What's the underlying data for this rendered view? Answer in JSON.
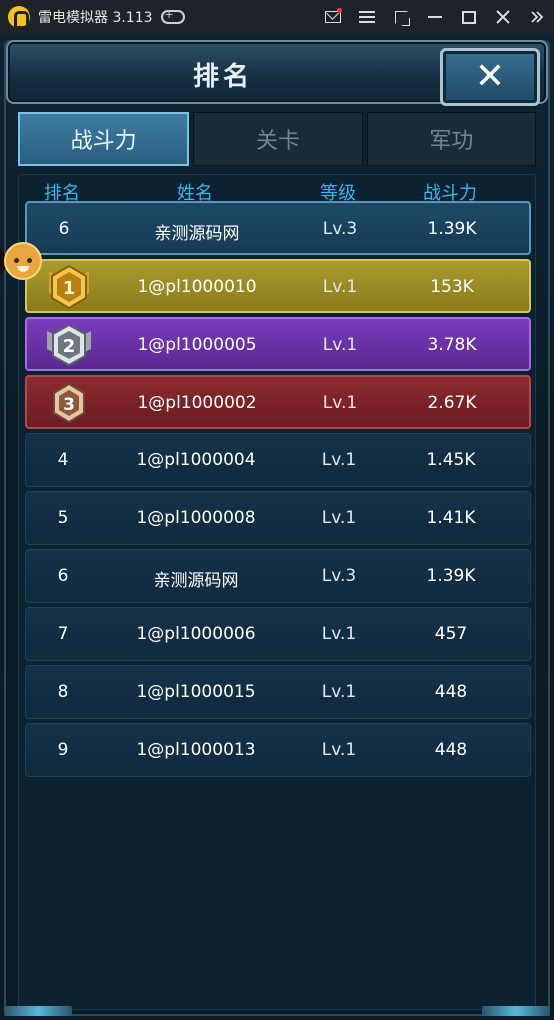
{
  "emulator": {
    "title": "雷电模拟器 3.113",
    "icons": [
      "logo-icon",
      "gamepad-icon",
      "mail-icon",
      "menu-icon",
      "resize-icon",
      "minimize-icon",
      "maximize-icon",
      "close-icon",
      "double-chevron-icon"
    ]
  },
  "header": {
    "title": "排名",
    "close_label": "✕"
  },
  "tabs": [
    {
      "label": "战斗力",
      "active": true
    },
    {
      "label": "关卡",
      "active": false
    },
    {
      "label": "军功",
      "active": false
    }
  ],
  "columns": {
    "rank": "排名",
    "name": "姓名",
    "level": "等级",
    "power": "战斗力"
  },
  "my_rank": {
    "rank": "6",
    "name": "亲测源码网",
    "level": "Lv.3",
    "power": "1.39K"
  },
  "rows": [
    {
      "rank": "1",
      "name": "1@pl1000010",
      "level": "Lv.1",
      "power": "153K",
      "style": "gold"
    },
    {
      "rank": "2",
      "name": "1@pl1000005",
      "level": "Lv.1",
      "power": "3.78K",
      "style": "purple"
    },
    {
      "rank": "3",
      "name": "1@pl1000002",
      "level": "Lv.1",
      "power": "2.67K",
      "style": "red"
    },
    {
      "rank": "4",
      "name": "1@pl1000004",
      "level": "Lv.1",
      "power": "1.45K",
      "style": "normal"
    },
    {
      "rank": "5",
      "name": "1@pl1000008",
      "level": "Lv.1",
      "power": "1.41K",
      "style": "normal"
    },
    {
      "rank": "6",
      "name": "亲测源码网",
      "level": "Lv.3",
      "power": "1.39K",
      "style": "normal"
    },
    {
      "rank": "7",
      "name": "1@pl1000006",
      "level": "Lv.1",
      "power": "457",
      "style": "normal"
    },
    {
      "rank": "8",
      "name": "1@pl1000015",
      "level": "Lv.1",
      "power": "448",
      "style": "normal"
    },
    {
      "rank": "9",
      "name": "1@pl1000013",
      "level": "Lv.1",
      "power": "448",
      "style": "normal"
    }
  ],
  "colors": {
    "accent": "#37b7f0",
    "gold": "#a99b2c",
    "purple": "#7a3cbc",
    "red": "#8c2a2f"
  }
}
